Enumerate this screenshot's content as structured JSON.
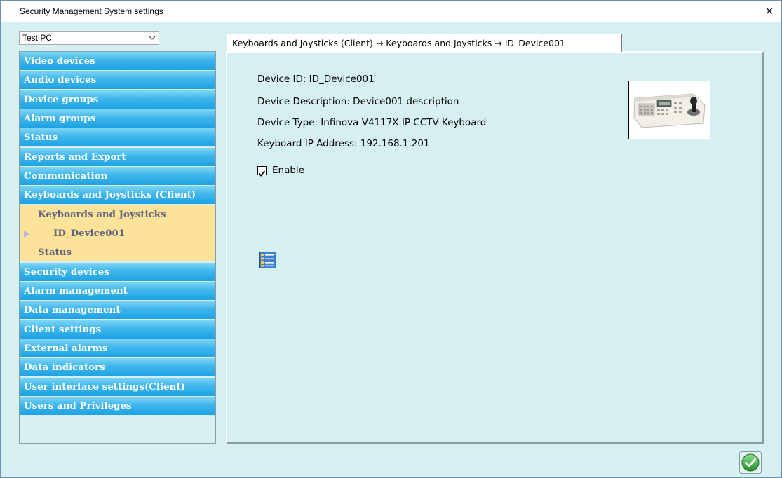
{
  "window": {
    "title": "Security Management System settings",
    "close_glyph": "✕"
  },
  "pc_select": {
    "value": "Test PC"
  },
  "nav": {
    "items": [
      {
        "label": "Video devices"
      },
      {
        "label": "Audio devices"
      },
      {
        "label": "Device groups"
      },
      {
        "label": "Alarm groups"
      },
      {
        "label": "Status"
      },
      {
        "label": "Reports and Export"
      },
      {
        "label": "Communication"
      },
      {
        "label": "Keyboards and Joysticks (Client)"
      }
    ],
    "sub_items": [
      {
        "label": "Keyboards and Joysticks"
      },
      {
        "label": "ID_Device001"
      },
      {
        "label": "Status"
      }
    ],
    "items_after": [
      {
        "label": "Security devices"
      },
      {
        "label": "Alarm management"
      },
      {
        "label": "Data management"
      },
      {
        "label": "Client settings"
      },
      {
        "label": "External alarms"
      },
      {
        "label": "Data indicators"
      },
      {
        "label": "User interface settings(Client)"
      },
      {
        "label": "Users and Privileges"
      }
    ]
  },
  "tab": {
    "label": "Keyboards and Joysticks (Client) → Keyboards and Joysticks → ID_Device001"
  },
  "device": {
    "id_line": "Device ID: ID_Device001",
    "description_line": "Device Description: Device001 description",
    "type_line": "Device Type: Infinova V4117X IP CCTV Keyboard",
    "ip_line": "Keyboard IP Address: 192.168.1.201",
    "enable_label": "Enable",
    "enable_checked": true,
    "image_icon": "cctv-keyboard-image"
  },
  "icons": {
    "list": "list-settings-icon",
    "ok": "ok-checkmark-icon"
  },
  "colors": {
    "nav_blue": "#1ea2e3",
    "nav_sub_yellow": "#fde39a",
    "panel_background": "#d6eff0",
    "ok_green": "#3fb93f"
  }
}
